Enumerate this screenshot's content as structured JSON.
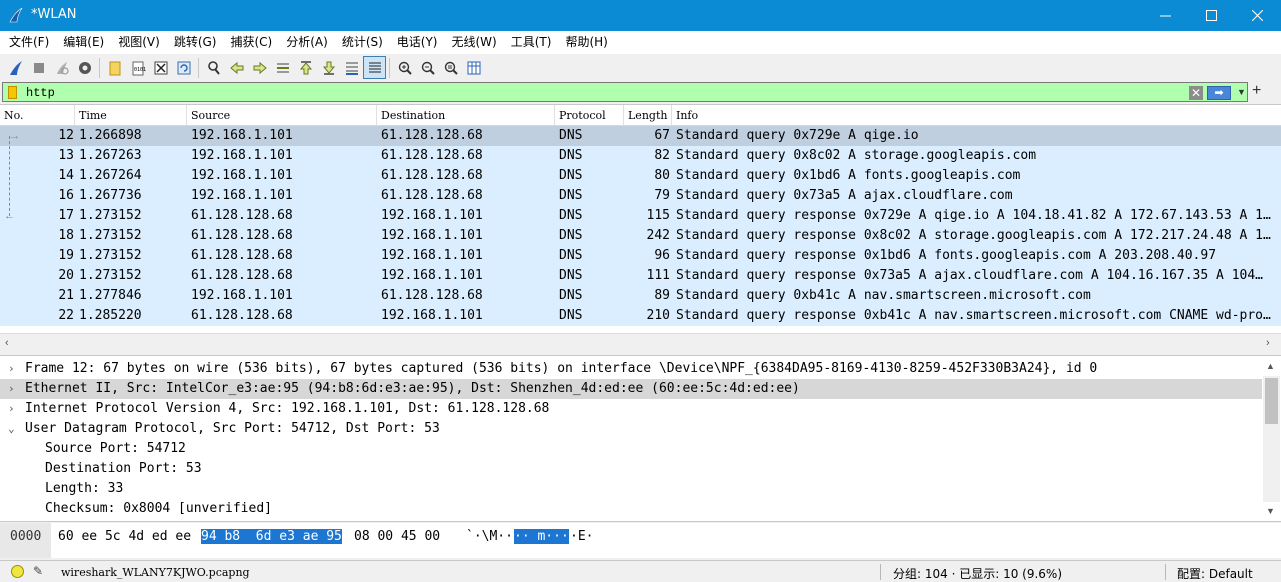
{
  "window": {
    "title": "*WLAN",
    "controls": {
      "minimize": "—",
      "maximize": "☐",
      "close": "✕"
    }
  },
  "menu": [
    "文件(F)",
    "编辑(E)",
    "视图(V)",
    "跳转(G)",
    "捕获(C)",
    "分析(A)",
    "统计(S)",
    "电话(Y)",
    "无线(W)",
    "工具(T)",
    "帮助(H)"
  ],
  "toolbar": {
    "icons": [
      "start-capture-icon",
      "stop-capture-icon",
      "restart-capture-icon",
      "capture-options-icon",
      "open-file-icon",
      "save-file-icon",
      "close-file-icon",
      "reload-file-icon",
      "find-packet-icon",
      "go-back-icon",
      "go-forward-icon",
      "go-to-packet-icon",
      "first-packet-icon",
      "last-packet-icon",
      "auto-scroll-icon",
      "colorize-icon",
      "zoom-in-icon",
      "zoom-out-icon",
      "zoom-normal-icon",
      "resize-columns-icon"
    ]
  },
  "filter": {
    "value": "http",
    "clear_label": "✕",
    "apply_label": "➡",
    "add_label": "+",
    "colors": {
      "valid_background": "#afffaf"
    }
  },
  "packet_list": {
    "columns": [
      "No.",
      "Time",
      "Source",
      "Destination",
      "Protocol",
      "Length",
      "Info"
    ],
    "selected_no": "12",
    "rows": [
      {
        "no": "12",
        "time": "1.266898",
        "src": "192.168.1.101",
        "dst": "61.128.128.68",
        "proto": "DNS",
        "len": "67",
        "info": "Standard query 0x729e A qige.io"
      },
      {
        "no": "13",
        "time": "1.267263",
        "src": "192.168.1.101",
        "dst": "61.128.128.68",
        "proto": "DNS",
        "len": "82",
        "info": "Standard query 0x8c02 A storage.googleapis.com"
      },
      {
        "no": "14",
        "time": "1.267264",
        "src": "192.168.1.101",
        "dst": "61.128.128.68",
        "proto": "DNS",
        "len": "80",
        "info": "Standard query 0x1bd6 A fonts.googleapis.com"
      },
      {
        "no": "16",
        "time": "1.267736",
        "src": "192.168.1.101",
        "dst": "61.128.128.68",
        "proto": "DNS",
        "len": "79",
        "info": "Standard query 0x73a5 A ajax.cloudflare.com"
      },
      {
        "no": "17",
        "time": "1.273152",
        "src": "61.128.128.68",
        "dst": "192.168.1.101",
        "proto": "DNS",
        "len": "115",
        "info": "Standard query response 0x729e A qige.io A 104.18.41.82 A 172.67.143.53 A 1…"
      },
      {
        "no": "18",
        "time": "1.273152",
        "src": "61.128.128.68",
        "dst": "192.168.1.101",
        "proto": "DNS",
        "len": "242",
        "info": "Standard query response 0x8c02 A storage.googleapis.com A 172.217.24.48 A 1…"
      },
      {
        "no": "19",
        "time": "1.273152",
        "src": "61.128.128.68",
        "dst": "192.168.1.101",
        "proto": "DNS",
        "len": "96",
        "info": "Standard query response 0x1bd6 A fonts.googleapis.com A 203.208.40.97"
      },
      {
        "no": "20",
        "time": "1.273152",
        "src": "61.128.128.68",
        "dst": "192.168.1.101",
        "proto": "DNS",
        "len": "111",
        "info": "Standard query response 0x73a5 A ajax.cloudflare.com A 104.16.167.35 A 104…"
      },
      {
        "no": "21",
        "time": "1.277846",
        "src": "192.168.1.101",
        "dst": "61.128.128.68",
        "proto": "DNS",
        "len": "89",
        "info": "Standard query 0xb41c A nav.smartscreen.microsoft.com"
      },
      {
        "no": "22",
        "time": "1.285220",
        "src": "61.128.128.68",
        "dst": "192.168.1.101",
        "proto": "DNS",
        "len": "210",
        "info": "Standard query response 0xb41c A nav.smartscreen.microsoft.com CNAME wd-pro…"
      }
    ],
    "colors": {
      "row": "#daeeff",
      "selected": "#bfcfe0"
    }
  },
  "details": {
    "rows": [
      {
        "arrow": "›",
        "indent": 0,
        "text": "Frame 12: 67 bytes on wire (536 bits), 67 bytes captured (536 bits) on interface \\Device\\NPF_{6384DA95-8169-4130-8259-452F330B3A24}, id 0",
        "selected": false
      },
      {
        "arrow": "›",
        "indent": 0,
        "text": "Ethernet II, Src: IntelCor_e3:ae:95 (94:b8:6d:e3:ae:95), Dst: Shenzhen_4d:ed:ee (60:ee:5c:4d:ed:ee)",
        "selected": true
      },
      {
        "arrow": "›",
        "indent": 0,
        "text": "Internet Protocol Version 4, Src: 192.168.1.101, Dst: 61.128.128.68",
        "selected": false
      },
      {
        "arrow": "⌄",
        "indent": 0,
        "text": "User Datagram Protocol, Src Port: 54712, Dst Port: 53",
        "selected": false
      },
      {
        "arrow": "",
        "indent": 1,
        "text": "Source Port: 54712",
        "selected": false
      },
      {
        "arrow": "",
        "indent": 1,
        "text": "Destination Port: 53",
        "selected": false
      },
      {
        "arrow": "",
        "indent": 1,
        "text": "Length: 33",
        "selected": false
      },
      {
        "arrow": "",
        "indent": 1,
        "text": "Checksum: 0x8004 [unverified]",
        "selected": false
      }
    ]
  },
  "bytes": {
    "offset": "0000",
    "hex_before": "60 ee 5c 4d ed ee",
    "hex_highlight": "94 b8  6d e3 ae 95",
    "hex_after": "08 00 45 00",
    "ascii_before": "`·\\M··",
    "ascii_highlight": "·· m···",
    "ascii_after": "·E·"
  },
  "status": {
    "file": "wireshark_WLANY7KJWO.pcapng",
    "stats": "分组: 104 · 已显示: 10 (9.6%)",
    "profile": "配置: Default"
  }
}
